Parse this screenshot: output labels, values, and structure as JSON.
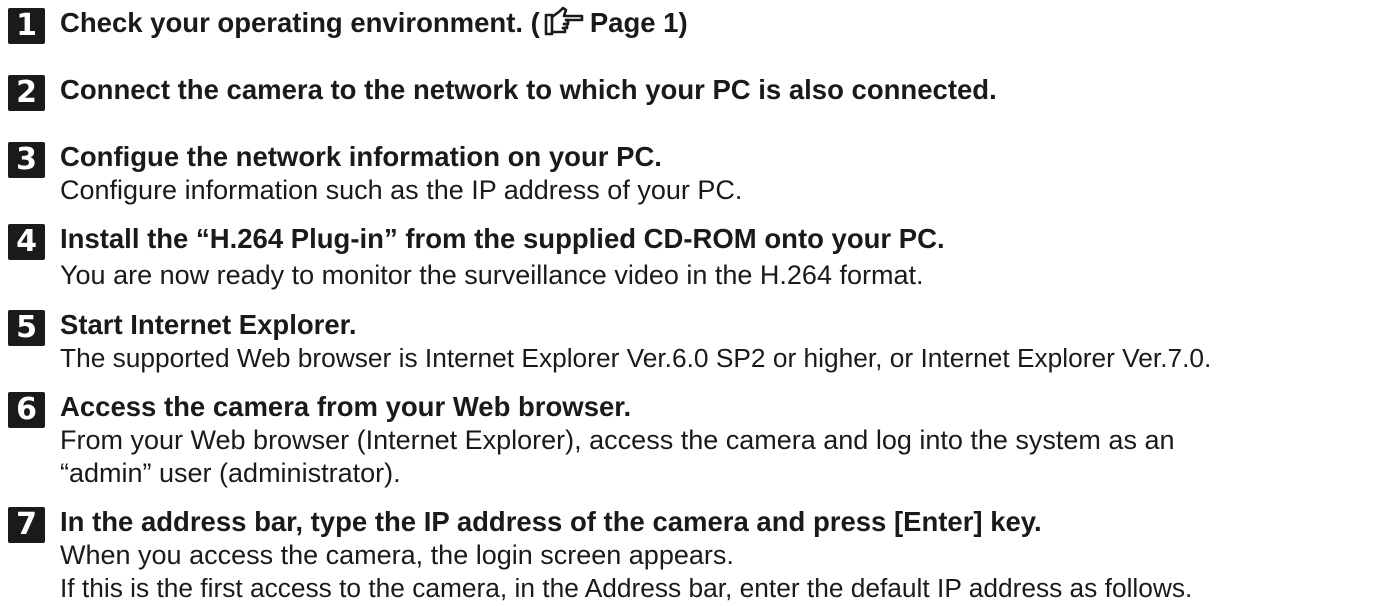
{
  "steps": [
    {
      "number": "1",
      "title": "Check your operating environment. (",
      "ref_icon": "pointing-hand-reference-icon",
      "ref_text": "Page 1)",
      "lines": []
    },
    {
      "number": "2",
      "title": "Connect the camera to the network to which your PC is also connected.",
      "lines": []
    },
    {
      "number": "3",
      "title": "Configue the network information on your PC.",
      "lines": [
        "Configure information such as the IP address of your PC."
      ]
    },
    {
      "number": "4",
      "title": "Install the “H.264 Plug-in” from the supplied CD-ROM onto your PC.",
      "lines": [
        "You are now ready to monitor the surveillance video in the H.264 format."
      ]
    },
    {
      "number": "5",
      "title": "Start Internet Explorer.",
      "lines": [
        "The supported Web browser is Internet Explorer Ver.6.0 SP2 or higher, or Internet Explorer Ver.7.0."
      ]
    },
    {
      "number": "6",
      "title": "Access the camera from your Web browser.",
      "lines": [
        "From your Web browser (Internet Explorer), access the camera and log into the system as an",
        "“admin” user (administrator)."
      ]
    },
    {
      "number": "7",
      "title": "In the address bar, type the IP address of the camera and press [Enter] key.",
      "lines": [
        "When you access the camera, the login screen appears.",
        "If this is the first access to the camera, in the Address bar, enter the default IP address as follows."
      ]
    }
  ]
}
